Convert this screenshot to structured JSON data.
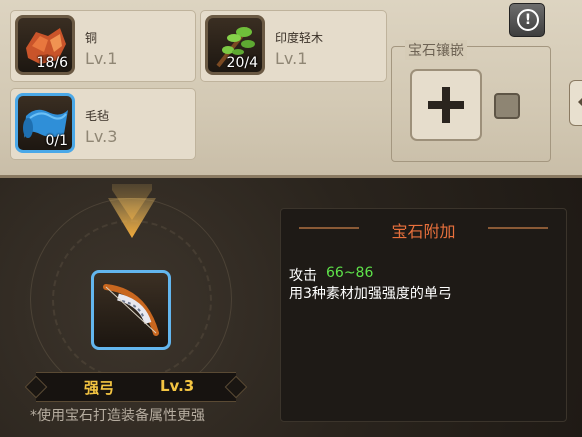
{
  "materials": [
    {
      "name": "铜",
      "level": "Lv.1",
      "count": "18/6",
      "icon": "copper-ore-icon"
    },
    {
      "name": "印度轻木",
      "level": "Lv.1",
      "count": "20/4",
      "icon": "wood-branch-icon"
    },
    {
      "name": "毛毡",
      "level": "Lv.3",
      "count": "0/1",
      "icon": "felt-cloth-icon"
    }
  ],
  "gem": {
    "title": "宝石镶嵌"
  },
  "info_button": {
    "glyph": "!"
  },
  "item": {
    "name": "强弓",
    "level": "Lv.3",
    "icon": "bow-icon"
  },
  "hint": "*使用宝石打造装备属性更强",
  "attr_panel": {
    "title": "宝石附加",
    "stat_label": "攻击",
    "stat_value": "66~86",
    "description": "用3种素材加强强度的单弓"
  },
  "colors": {
    "accent_gold": "#f4c542",
    "stat_green": "#5fe34a",
    "title_orange": "#e8703c"
  }
}
